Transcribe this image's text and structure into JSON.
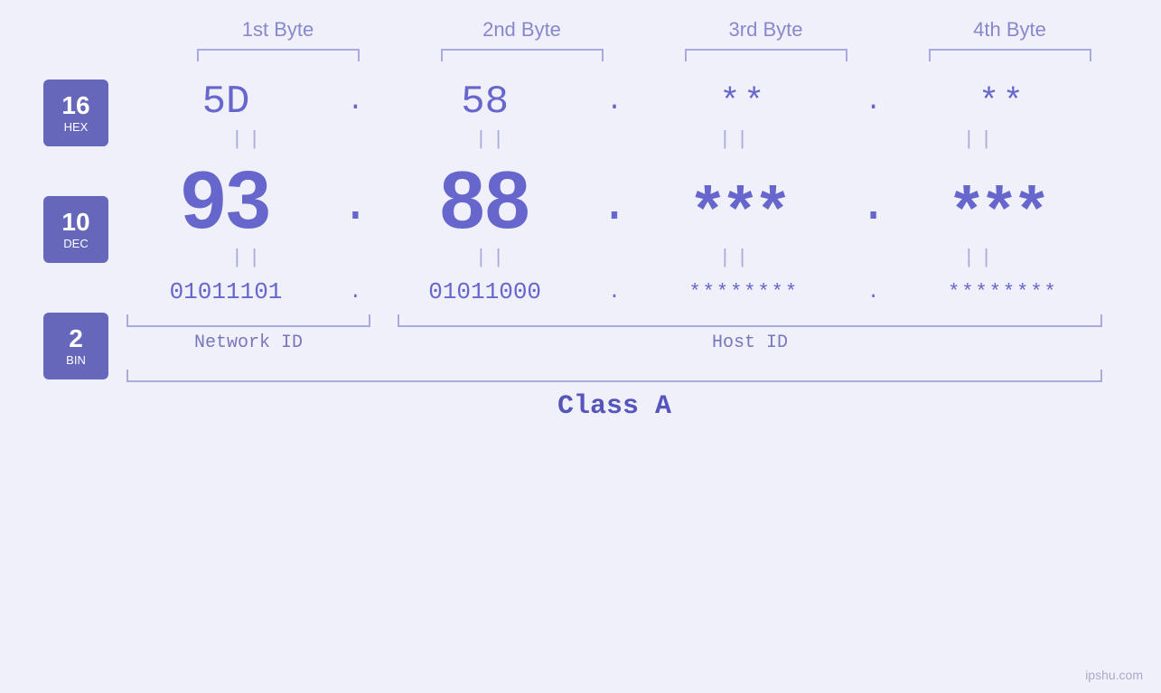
{
  "headers": {
    "byte1": "1st Byte",
    "byte2": "2nd Byte",
    "byte3": "3rd Byte",
    "byte4": "4th Byte"
  },
  "badges": [
    {
      "num": "16",
      "label": "HEX"
    },
    {
      "num": "10",
      "label": "DEC"
    },
    {
      "num": "2",
      "label": "BIN"
    }
  ],
  "hex_row": {
    "b1": "5D",
    "b2": "58",
    "b3": "**",
    "b4": "**"
  },
  "dec_row": {
    "b1": "93",
    "b2": "88",
    "b3": "***",
    "b4": "***"
  },
  "bin_row": {
    "b1": "01011101",
    "b2": "01011000",
    "b3": "********",
    "b4": "********"
  },
  "labels": {
    "network_id": "Network ID",
    "host_id": "Host ID",
    "class": "Class A"
  },
  "watermark": "ipshu.com",
  "separator": "||"
}
